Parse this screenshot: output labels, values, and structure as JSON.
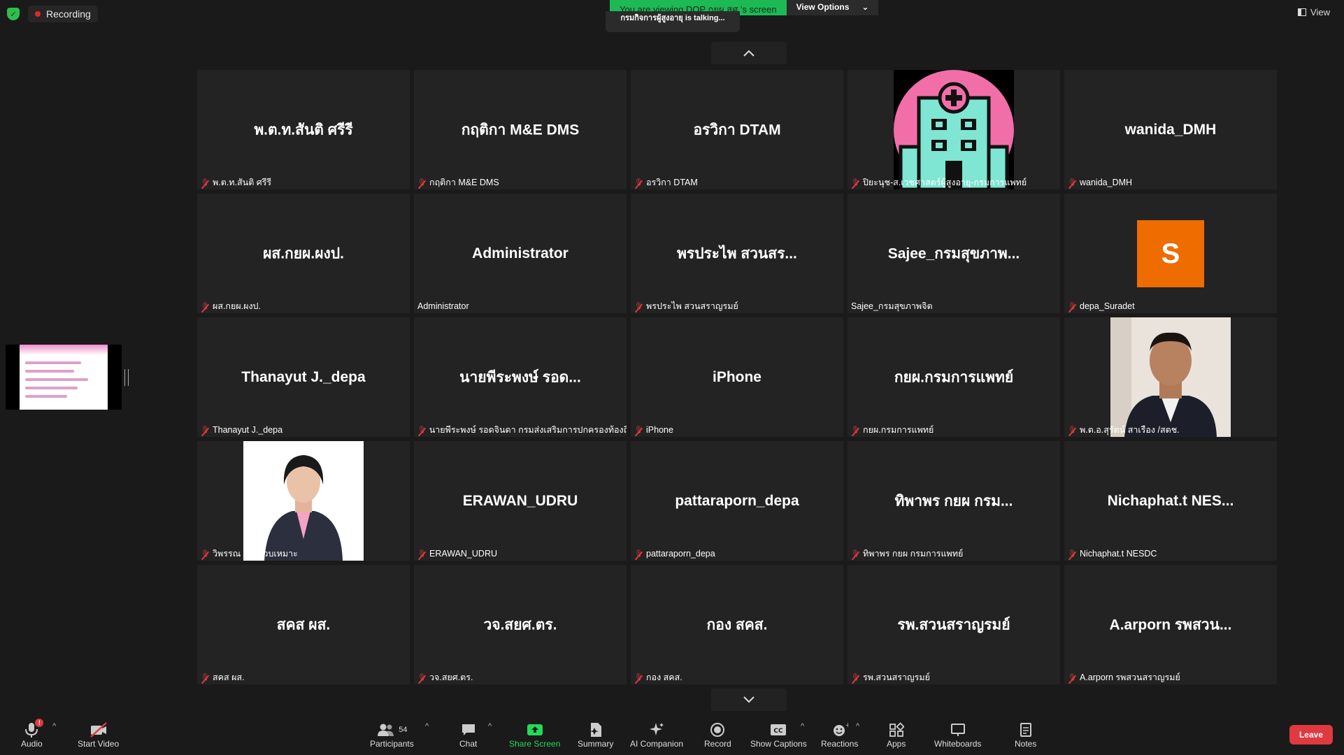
{
  "status": {
    "recording_label": "Recording"
  },
  "share_banner": {
    "viewing_text": "You are viewing DOP กยผ.สศ.'s screen",
    "view_options_label": "View Options",
    "talking_text": "กรมกิจการผู้สูงอายุ is talking..."
  },
  "top_right": {
    "view_label": "View"
  },
  "tiles": [
    {
      "display": "พ.ต.ท.สันติ ศรีรี",
      "label": "พ.ต.ท.สันติ ศรีรี",
      "muted": true,
      "kind": "name"
    },
    {
      "display": "กฤติกา M&E  DMS",
      "label": "กฤติกา M&E  DMS",
      "muted": true,
      "kind": "name"
    },
    {
      "display": "อรวิกา DTAM",
      "label": "อรวิกา DTAM",
      "muted": true,
      "kind": "name"
    },
    {
      "display": "",
      "label": "ปิยะนุช-ส.เวชศาสตร์ผู้สูงอายุ-กรมการแพทย์",
      "muted": true,
      "kind": "hospital"
    },
    {
      "display": "wanida_DMH",
      "label": "wanida_DMH",
      "muted": true,
      "kind": "name"
    },
    {
      "display": "ผส.กยผ.ผงป.",
      "label": "ผส.กยผ.ผงป.",
      "muted": true,
      "kind": "name"
    },
    {
      "display": "Administrator",
      "label": "Administrator",
      "muted": false,
      "kind": "name"
    },
    {
      "display": "พรประไพ  สวนสร...",
      "label": "พรประไพ  สวนสราญรมย์",
      "muted": true,
      "kind": "name"
    },
    {
      "display": "Sajee_กรมสุขภาพ...",
      "label": "Sajee_กรมสุขภาพจิต",
      "muted": false,
      "kind": "name"
    },
    {
      "display": "S",
      "label": "depa_Suradet",
      "muted": true,
      "kind": "avatar"
    },
    {
      "display": "Thanayut J._depa",
      "label": "Thanayut J._depa",
      "muted": true,
      "kind": "name"
    },
    {
      "display": "นายพีระพงษ์ รอด...",
      "label": "นายพีระพงษ์ รอดจินดา กรมส่งเสริมการปกครองท้องถิ่น",
      "muted": true,
      "kind": "name"
    },
    {
      "display": "iPhone",
      "label": "iPhone",
      "muted": true,
      "kind": "name"
    },
    {
      "display": "กยผ.กรมการแพทย์",
      "label": "กยผ.กรมการแพทย์",
      "muted": true,
      "kind": "name"
    },
    {
      "display": "",
      "label": "พ.ต.อ.สุรัตน์ สาเรือง /สตช.",
      "muted": true,
      "kind": "photo-man"
    },
    {
      "display": "",
      "label": "วิพรรณ ประจวบเหมาะ",
      "muted": true,
      "kind": "photo-woman"
    },
    {
      "display": "ERAWAN_UDRU",
      "label": "ERAWAN_UDRU",
      "muted": true,
      "kind": "name"
    },
    {
      "display": "pattaraporn_depa",
      "label": "pattaraporn_depa",
      "muted": true,
      "kind": "name"
    },
    {
      "display": "ทิพาพร กยผ กรม...",
      "label": "ทิพาพร กยผ กรมการแพทย์",
      "muted": true,
      "kind": "name"
    },
    {
      "display": "Nichaphat.t  NES...",
      "label": "Nichaphat.t NESDC",
      "muted": true,
      "kind": "name"
    },
    {
      "display": "สคส ผส.",
      "label": "สคส ผส.",
      "muted": true,
      "kind": "name"
    },
    {
      "display": "วจ.สยศ.ตร.",
      "label": "วจ.สยศ.ตร.",
      "muted": true,
      "kind": "name"
    },
    {
      "display": "กอง สคส.",
      "label": "กอง สคส.",
      "muted": true,
      "kind": "name"
    },
    {
      "display": "รพ.สวนสราญรมย์",
      "label": "รพ.สวนสราญรมย์",
      "muted": true,
      "kind": "name"
    },
    {
      "display": "A.arporn รพสวน...",
      "label": "A.arporn รพสวนสราญรมย์",
      "muted": true,
      "kind": "name"
    }
  ],
  "toolbar": {
    "audio": "Audio",
    "start_video": "Start Video",
    "participants": "Participants",
    "participants_count": "54",
    "chat": "Chat",
    "share_screen": "Share Screen",
    "summary": "Summary",
    "ai_companion": "AI Companion",
    "record": "Record",
    "show_captions": "Show Captions",
    "reactions": "Reactions",
    "apps": "Apps",
    "whiteboards": "Whiteboards",
    "notes": "Notes",
    "leave": "Leave",
    "audio_badge": "!"
  },
  "colors": {
    "accent_green": "#1db954",
    "leave_red": "#e0393e",
    "share_green": "#23d959",
    "avatar_orange": "#ef6c00"
  }
}
